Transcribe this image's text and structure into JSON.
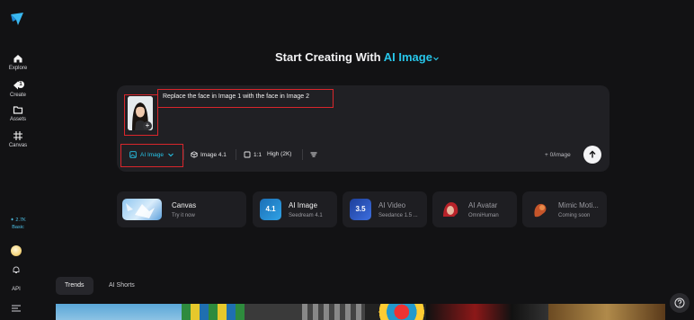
{
  "sidebar": {
    "items": [
      {
        "label": "Explore"
      },
      {
        "label": "Create",
        "badge": "1"
      },
      {
        "label": "Assets"
      },
      {
        "label": "Canvas"
      }
    ],
    "credits": {
      "amount": "2.7K",
      "plan": "Basic"
    },
    "api_label": "API"
  },
  "heading": {
    "prefix": "Start Creating With",
    "mode": "AI Image"
  },
  "prompt": {
    "text": "Replace the face in Image 1 with the face in Image 2",
    "thumbnail_add": "+"
  },
  "toolbar": {
    "mode_label": "AI Image",
    "model_label": "Image 4.1",
    "ratio_label": "1:1",
    "quality_label": "High (2K)",
    "cost_label": "+ 0/image"
  },
  "tools": [
    {
      "name": "Canvas",
      "sub": "Try it now"
    },
    {
      "name": "AI Image",
      "sub": "Seedream 4.1",
      "icon_text": "4.1"
    },
    {
      "name": "AI Video",
      "sub": "Seedance 1.5 ...",
      "icon_text": "3.5"
    },
    {
      "name": "AI Avatar",
      "sub": "OmniHuman"
    },
    {
      "name": "Mimic Moti...",
      "sub": "Coming soon"
    }
  ],
  "tabs": [
    {
      "label": "Trends",
      "active": true
    },
    {
      "label": "AI Shorts",
      "active": false
    }
  ],
  "colors": {
    "accent": "#27c6ea",
    "highlight_box": "#d9262c",
    "background": "#121214",
    "card": "#202024"
  }
}
